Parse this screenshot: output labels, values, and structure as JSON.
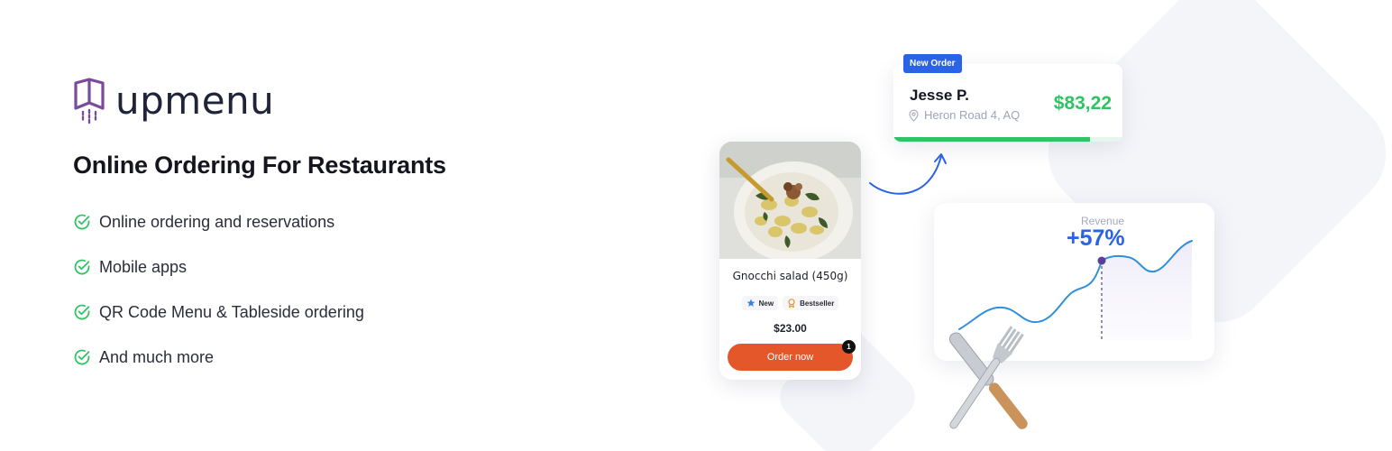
{
  "brand": {
    "name": "upmenu",
    "accent_color": "#7a4b9a"
  },
  "headline": "Online Ordering For Restaurants",
  "features": [
    "Online ordering and reservations",
    "Mobile apps",
    "QR Code Menu & Tableside ordering",
    "And much more"
  ],
  "order_card": {
    "badge": "New Order",
    "customer": "Jesse P.",
    "address": "Heron Road 4, AQ",
    "amount": "$83,22",
    "progress": 0.86,
    "amount_color": "#2fc463"
  },
  "product_card": {
    "title": "Gnocchi salad (450g)",
    "tags": [
      "New",
      "Bestseller"
    ],
    "price": "$23.00",
    "button": "Order now",
    "cart_count": "1",
    "button_color": "#e4572b"
  },
  "revenue_card": {
    "label": "Revenue",
    "value": "+57%",
    "accent_color": "#2a63e6"
  },
  "icons": {
    "check": "check-circle-icon",
    "location": "location-pin-icon",
    "star": "star-icon",
    "award": "award-icon"
  }
}
